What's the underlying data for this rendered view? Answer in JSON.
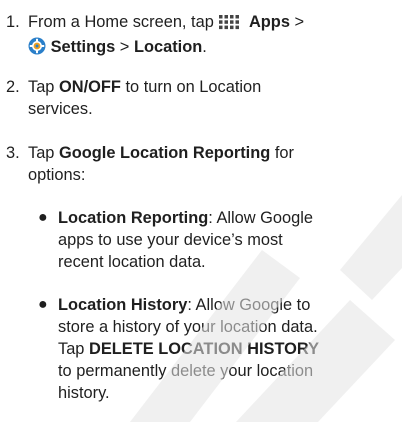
{
  "steps": [
    {
      "number": "1.",
      "intro": "From a Home screen, tap",
      "apps_icon": "apps-grid-icon",
      "apps_label": "Apps",
      "sep1": ">",
      "settings_icon": "gear-icon",
      "settings_label": "Settings",
      "sep2": ">",
      "location_label": "Location",
      "end": "."
    },
    {
      "number": "2.",
      "pre": "Tap",
      "bold": "ON/OFF",
      "post_line1": "to turn on Location",
      "post_line2": "services."
    },
    {
      "number": "3.",
      "pre": "Tap",
      "bold": "Google Location Reporting",
      "post_line1": "for",
      "post_line2": "options:"
    }
  ],
  "bullets": [
    {
      "title": "Location Reporting",
      "line1": ": Allow Google",
      "line2": "apps to use your device’s most",
      "line3": "recent location data."
    },
    {
      "title": "Location History",
      "line1": ": Allow Google to",
      "line2": "store a history of your location data.",
      "line3_pre": "Tap",
      "line3_bold": "DELETE LOCATION HISTORY",
      "line4": "to permanently delete your location",
      "line5": "history."
    }
  ],
  "colors": {
    "text": "#1f1f1f",
    "gear_blue": "#2a7fc9",
    "gear_orange": "#f0a020",
    "watermark": "#e4e4e4"
  }
}
